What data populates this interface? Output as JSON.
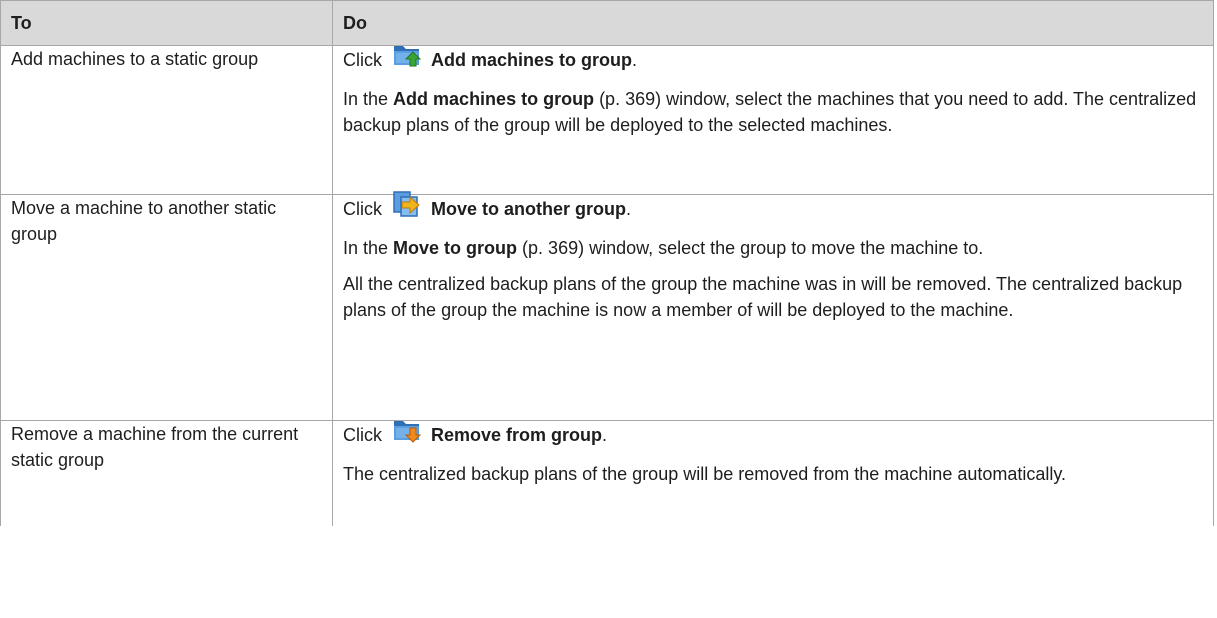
{
  "header": {
    "to": "To",
    "do": "Do"
  },
  "rows": [
    {
      "to": "Add machines to a static group",
      "click_word": "Click",
      "action": "Add machines to group",
      "action_icon": "add-to-group-icon",
      "paragraphs": [
        {
          "pre": "In the ",
          "bold": "Add machines to group",
          "post": " (p. 369) window, select the machines that you need to add. The centralized backup plans of the group will be deployed to the selected machines."
        }
      ]
    },
    {
      "to": "Move a machine to another static group",
      "click_word": "Click",
      "action": "Move to another group",
      "action_icon": "move-to-group-icon",
      "paragraphs": [
        {
          "pre": "In the ",
          "bold": "Move to group",
          "post": " (p. 369) window, select the group to move the machine to."
        },
        {
          "pre": "All the centralized backup plans of the group the machine was in will be removed. The centralized backup plans of the group the machine is now a member of will be deployed to the machine.",
          "bold": "",
          "post": ""
        }
      ]
    },
    {
      "to": "Remove a machine from the current static group",
      "click_word": "Click",
      "action": "Remove from group",
      "action_icon": "remove-from-group-icon",
      "paragraphs": [
        {
          "pre": "The centralized backup plans of the group will be removed from the machine automatically.",
          "bold": "",
          "post": ""
        }
      ]
    }
  ],
  "colors": {
    "header_bg": "#d9d9d9",
    "border": "#a7a7a7",
    "icon_folder": "#3f83c8",
    "icon_green": "#3aa537",
    "icon_orange": "#f08a1c"
  }
}
